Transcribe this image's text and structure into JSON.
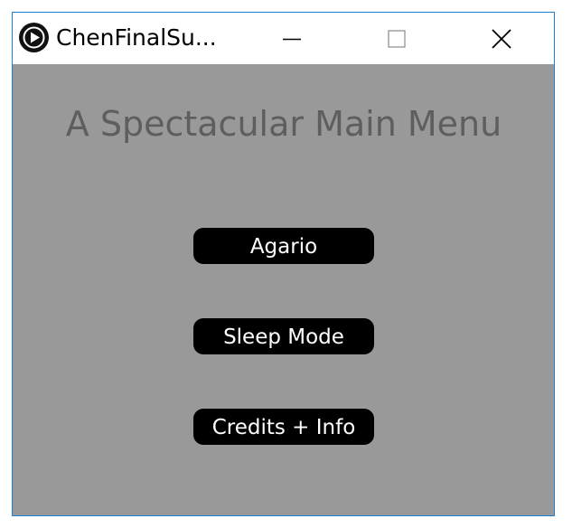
{
  "window": {
    "title": "ChenFinalSu...",
    "app_icon": "play-circle-icon",
    "controls": {
      "minimize_icon": "minimize-icon",
      "maximize_icon": "maximize-icon",
      "close_icon": "close-icon"
    }
  },
  "menu": {
    "heading": "A Spectacular Main Menu",
    "buttons": [
      {
        "label": "Agario"
      },
      {
        "label": "Sleep Mode"
      },
      {
        "label": "Credits + Info"
      }
    ]
  },
  "colors": {
    "client_background": "#999999",
    "heading_text": "#5e5e5e",
    "button_background": "#000000",
    "button_text": "#ffffff",
    "window_border": "#1e7fd6"
  }
}
